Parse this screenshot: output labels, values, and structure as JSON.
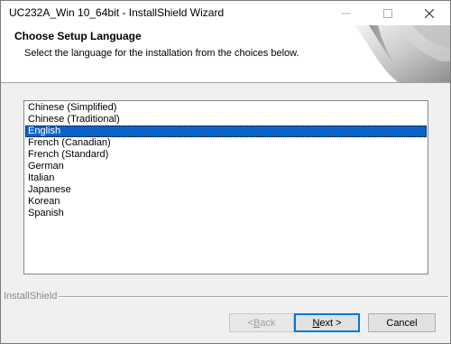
{
  "window": {
    "title": "UC232A_Win 10_64bit - InstallShield Wizard"
  },
  "header": {
    "title": "Choose Setup Language",
    "subtitle": "Select the language for the installation from the choices below."
  },
  "languages": [
    "Chinese (Simplified)",
    "Chinese (Traditional)",
    "English",
    "French (Canadian)",
    "French (Standard)",
    "German",
    "Italian",
    "Japanese",
    "Korean",
    "Spanish"
  ],
  "selected_language": "English",
  "brand": "InstallShield",
  "buttons": {
    "back": {
      "prefix": "< ",
      "accel": "B",
      "rest": "ack"
    },
    "next": {
      "accel": "N",
      "rest": "ext >"
    },
    "cancel": "Cancel"
  },
  "colors": {
    "selection": "#0a64c8",
    "default_button_border": "#0078d7"
  }
}
